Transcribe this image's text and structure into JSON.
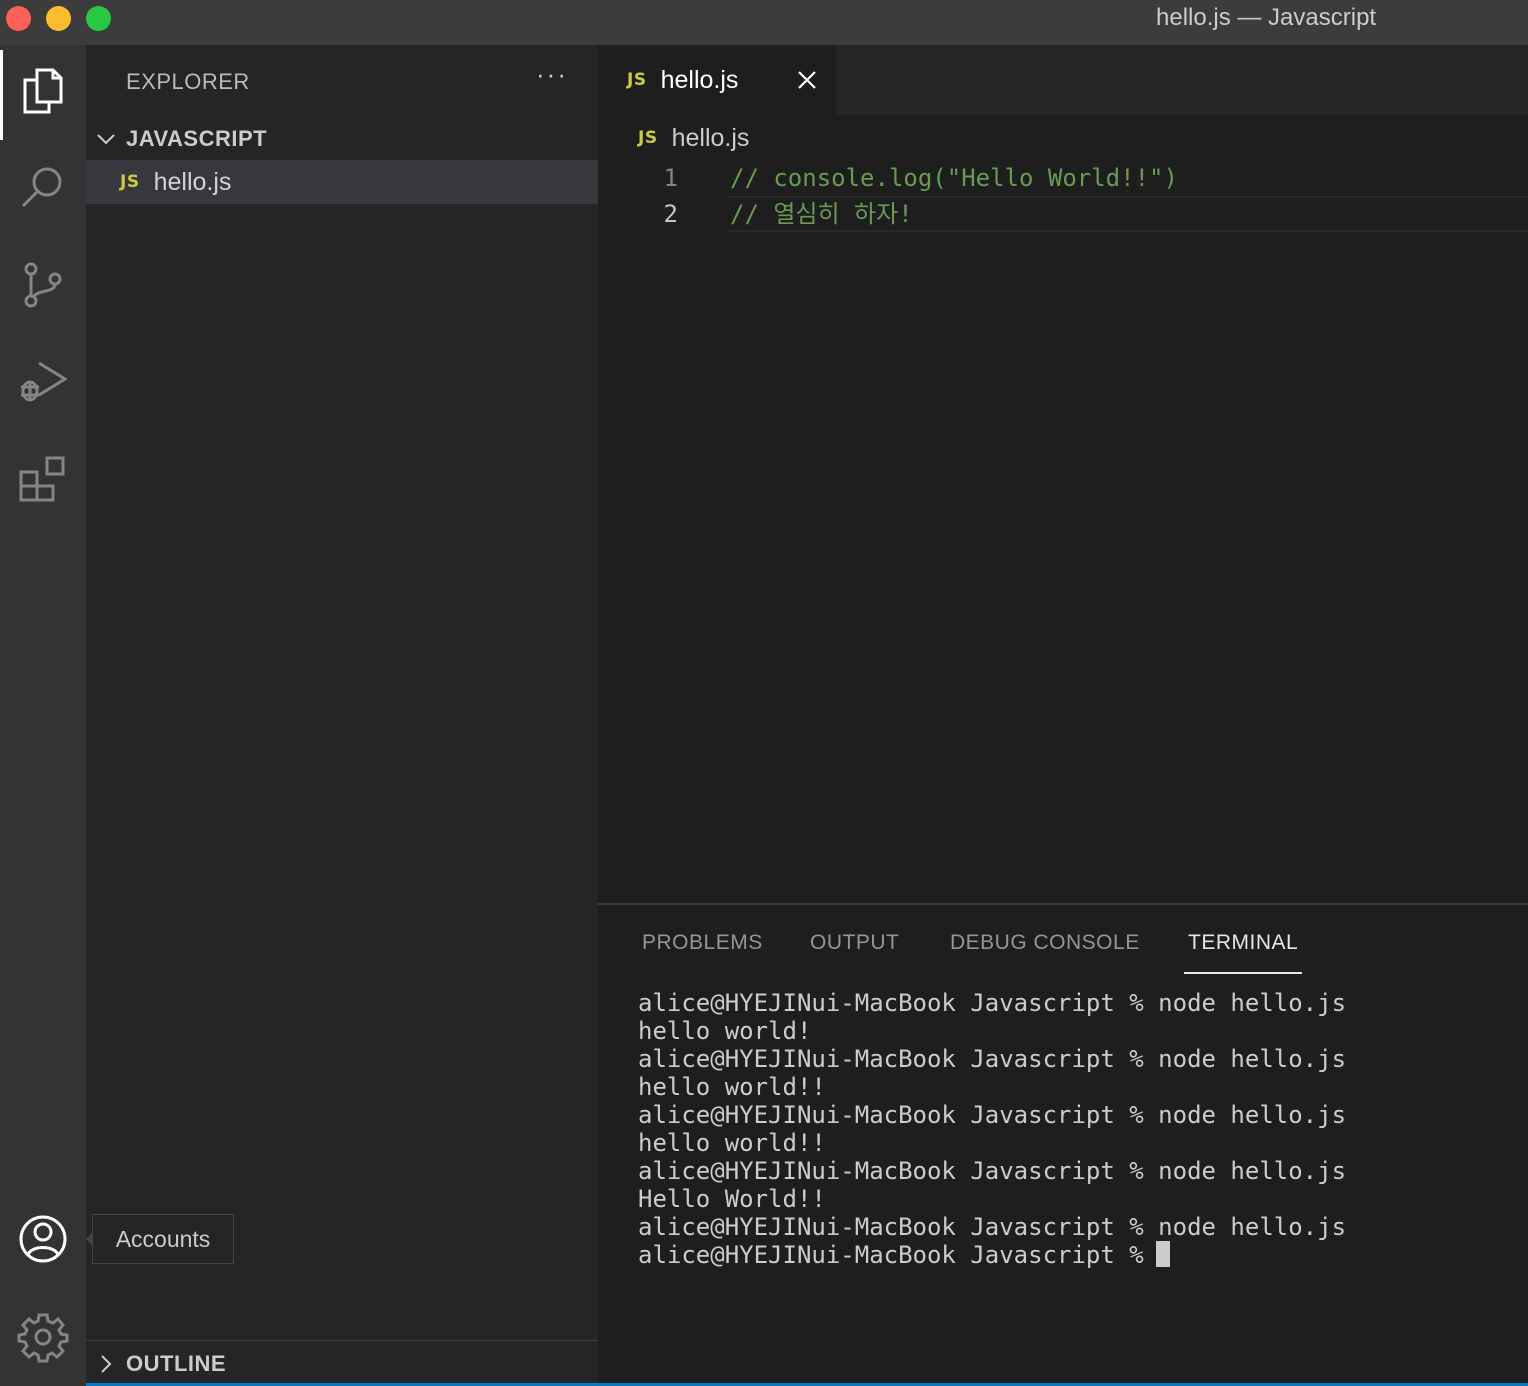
{
  "window": {
    "title": "hello.js — Javascript"
  },
  "activity_bar": {
    "items": [
      "explorer",
      "search",
      "source-control",
      "run-and-debug",
      "extensions"
    ],
    "bottom": [
      "accounts",
      "manage"
    ]
  },
  "sidebar": {
    "title": "EXPLORER",
    "more_actions": "···",
    "folder": "JAVASCRIPT",
    "files": [
      {
        "badge": "JS",
        "name": "hello.js"
      }
    ],
    "outline": "OUTLINE"
  },
  "editor": {
    "tab": {
      "badge": "JS",
      "label": "hello.js"
    },
    "breadcrumb": {
      "badge": "JS",
      "label": "hello.js"
    },
    "lines": [
      {
        "number": "1",
        "text": "// console.log(\"Hello World!!\")"
      },
      {
        "number": "2",
        "text": "// 열심히 하자!"
      }
    ]
  },
  "panel": {
    "tabs": [
      "PROBLEMS",
      "OUTPUT",
      "DEBUG CONSOLE",
      "TERMINAL"
    ],
    "active_tab": "TERMINAL",
    "terminal_lines": [
      "alice@HYEJINui-MacBook Javascript % node hello.js",
      "hello world!",
      "alice@HYEJINui-MacBook Javascript % node hello.js",
      "hello world!!",
      "alice@HYEJINui-MacBook Javascript % node hello.js",
      "hello world!!",
      "alice@HYEJINui-MacBook Javascript % node hello.js",
      "Hello World!!",
      "alice@HYEJINui-MacBook Javascript % node hello.js",
      "alice@HYEJINui-MacBook Javascript %"
    ]
  },
  "tooltip": {
    "text": "Accounts"
  },
  "colors": {
    "accent": "#007acc",
    "js_badge": "#cbcb41",
    "comment": "#6a9955"
  }
}
